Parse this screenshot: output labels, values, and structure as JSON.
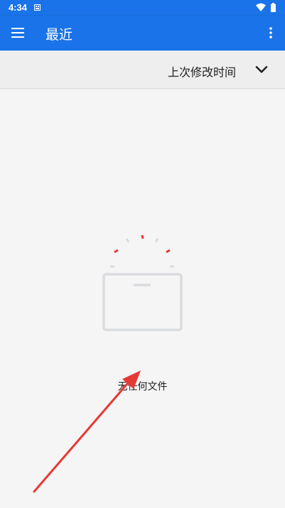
{
  "status_bar": {
    "time": "4:34",
    "icons": [
      "notification-icon",
      "wifi-icon",
      "battery-icon"
    ]
  },
  "app_bar": {
    "title": "最近",
    "menu_icon": "hamburger-menu-icon",
    "overflow_icon": "more-vert-icon"
  },
  "sort_bar": {
    "label": "上次修改时间",
    "icon": "chevron-down-icon"
  },
  "empty_state": {
    "message": "无任何文件",
    "icon": "empty-box-icon"
  },
  "annotation": {
    "icon": "red-arrow-icon"
  },
  "colors": {
    "primary": "#1a73e8",
    "background": "#f5f5f5",
    "sort_bar": "#eeeeee",
    "text": "#202124",
    "accent_red": "#e53935",
    "illustration_gray": "#dadce0"
  }
}
